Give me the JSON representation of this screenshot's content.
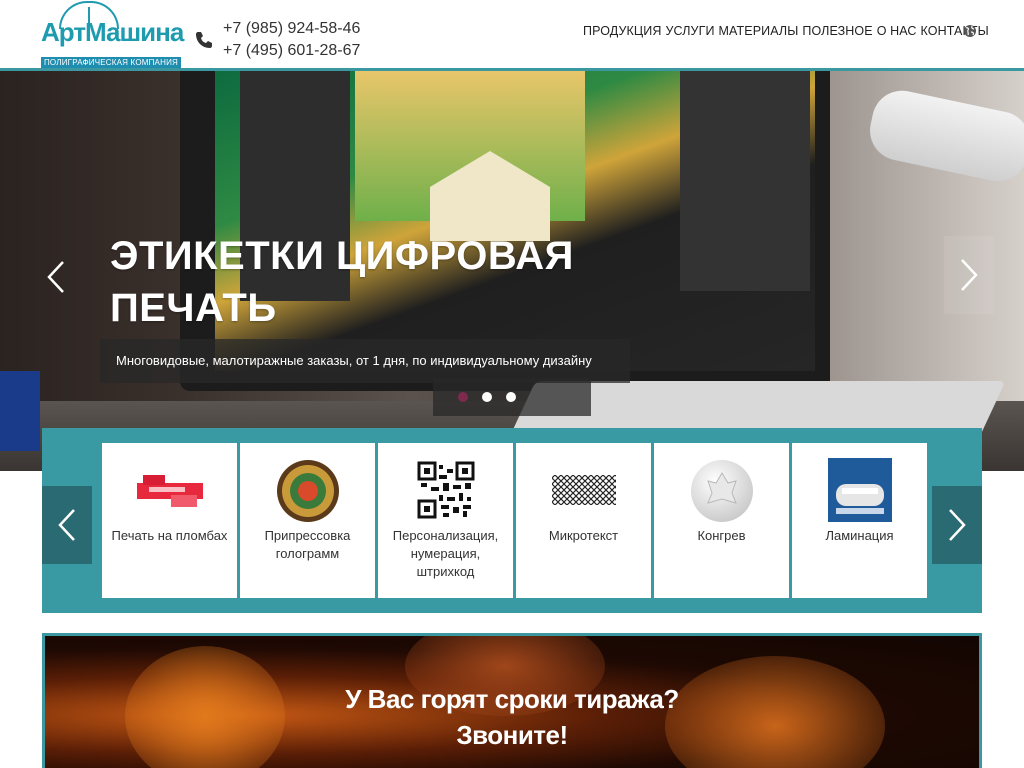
{
  "header": {
    "logo_text": "АртМашина",
    "logo_tagline": "ПОЛИГРАФИЧЕСКАЯ КОМПАНИЯ",
    "phones": [
      "+7 (985) 924-58-46",
      "+7 (495) 601-28-67"
    ],
    "nav": [
      "ПРОДУКЦИЯ",
      "УСЛУГИ",
      "МАТЕРИАЛЫ",
      "ПОЛЕЗНОЕ",
      "О НАС",
      "КОНТАКТЫ"
    ],
    "language_icon": "globe-icon"
  },
  "hero": {
    "title_line1": "ЭТИКЕТКИ ЦИФРОВАЯ",
    "title_line2": "ПЕЧАТЬ",
    "caption": "Многовидовые, малотиражные заказы, от 1 дня, по индивидуальному дизайну",
    "active_slide": 1,
    "slide_count": 3
  },
  "services": [
    {
      "label": "Печать на пломбах",
      "icon": "seal-tape-image"
    },
    {
      "label": "Припрессовка голограмм",
      "icon": "hologram-image"
    },
    {
      "label": "Персонализация, нумерация, штрихкод",
      "icon": "qr-code-image"
    },
    {
      "label": "Микротекст",
      "icon": "microtext-image"
    },
    {
      "label": "Конгрев",
      "icon": "emboss-image"
    },
    {
      "label": "Ламинация",
      "icon": "lamination-image"
    }
  ],
  "promo": {
    "line1": "У Вас горят сроки тиража?",
    "line2": "Звоните!"
  },
  "colors": {
    "accent": "#3b98a1",
    "accent_dark": "#2a6a73",
    "logo_blue": "#1f9bb0",
    "active_dot": "#7e2a4f"
  }
}
